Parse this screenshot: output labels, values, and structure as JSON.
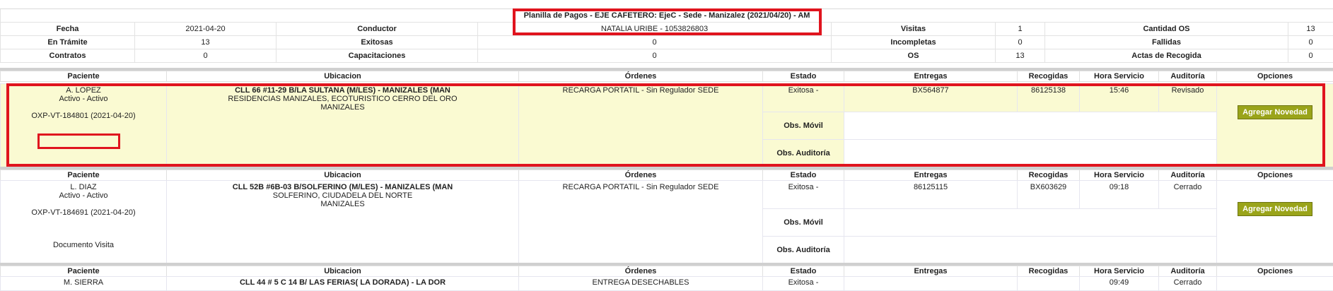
{
  "summary": {
    "title": "Planilla de Pagos - EJE CAFETERO: EjeC - Sede - Manizalez (2021/04/20) - AM",
    "rows": [
      {
        "l1": "Fecha",
        "v1": "2021-04-20",
        "l2": "Conductor",
        "v2": "NATALIA URIBE - 1053826803",
        "l3": "Visitas",
        "v3": "1",
        "l4": "Cantidad OS",
        "v4": "13"
      },
      {
        "l1": "En Trámite",
        "v1": "13",
        "l2": "Exitosas",
        "v2": "0",
        "l3": "Incompletas",
        "v3": "0",
        "l4": "Fallidas",
        "v4": "0"
      },
      {
        "l1": "Contratos",
        "v1": "0",
        "l2": "Capacitaciones",
        "v2": "0",
        "l3": "OS",
        "v3": "13",
        "l4": "Actas de Recogida",
        "v4": "0"
      }
    ]
  },
  "headers": {
    "paciente": "Paciente",
    "ubicacion": "Ubicacion",
    "ordenes": "Órdenes",
    "estado": "Estado",
    "entregas": "Entregas",
    "recogidas": "Recogidas",
    "hora": "Hora Servicio",
    "auditoria": "Auditoría",
    "opciones": "Opciones"
  },
  "labels": {
    "obs_movil": "Obs. Móvil",
    "obs_auditoria": "Obs. Auditoría",
    "add_button": "Agregar Novedad"
  },
  "records": [
    {
      "name": "A. LOPEZ",
      "status": "Activo - Activo",
      "code": "OXP-VT-184801 (2021-04-20)",
      "doc": "",
      "address": "CLL 66 #11-29 B/LA SULTANA (M/LES) - MANIZALES (MAN",
      "address2": "RESIDENCIAS MANIZALES, ECOTURISTICO CERRO DEL ORO",
      "city": "MANIZALES",
      "orden": "RECARGA PORTATIL - Sin Regulador SEDE",
      "estado": "Exitosa -",
      "entregas": "BX564877",
      "recogidas": "86125138",
      "hora": "15:46",
      "auditoria": "Revisado"
    },
    {
      "name": "L. DIAZ",
      "status": "Activo - Activo",
      "code": "OXP-VT-184691 (2021-04-20)",
      "doc": "Documento Visita",
      "address": "CLL 52B #6B-03 B/SOLFERINO (M/LES) - MANIZALES (MAN",
      "address2": "SOLFERINO, CIUDADELA DEL NORTE",
      "city": "MANIZALES",
      "orden": "RECARGA PORTATIL - Sin Regulador SEDE",
      "estado": "Exitosa -",
      "entregas": "86125115",
      "recogidas": "BX603629",
      "hora": "09:18",
      "auditoria": "Cerrado"
    },
    {
      "name": "M. SIERRA",
      "address": "CLL 44 # 5 C 14 B/ LAS FERIAS( LA DORADA) - LA DOR",
      "orden": "ENTREGA DESECHABLES",
      "estado": "Exitosa -",
      "hora": "09:49",
      "auditoria": "Cerrado"
    }
  ]
}
